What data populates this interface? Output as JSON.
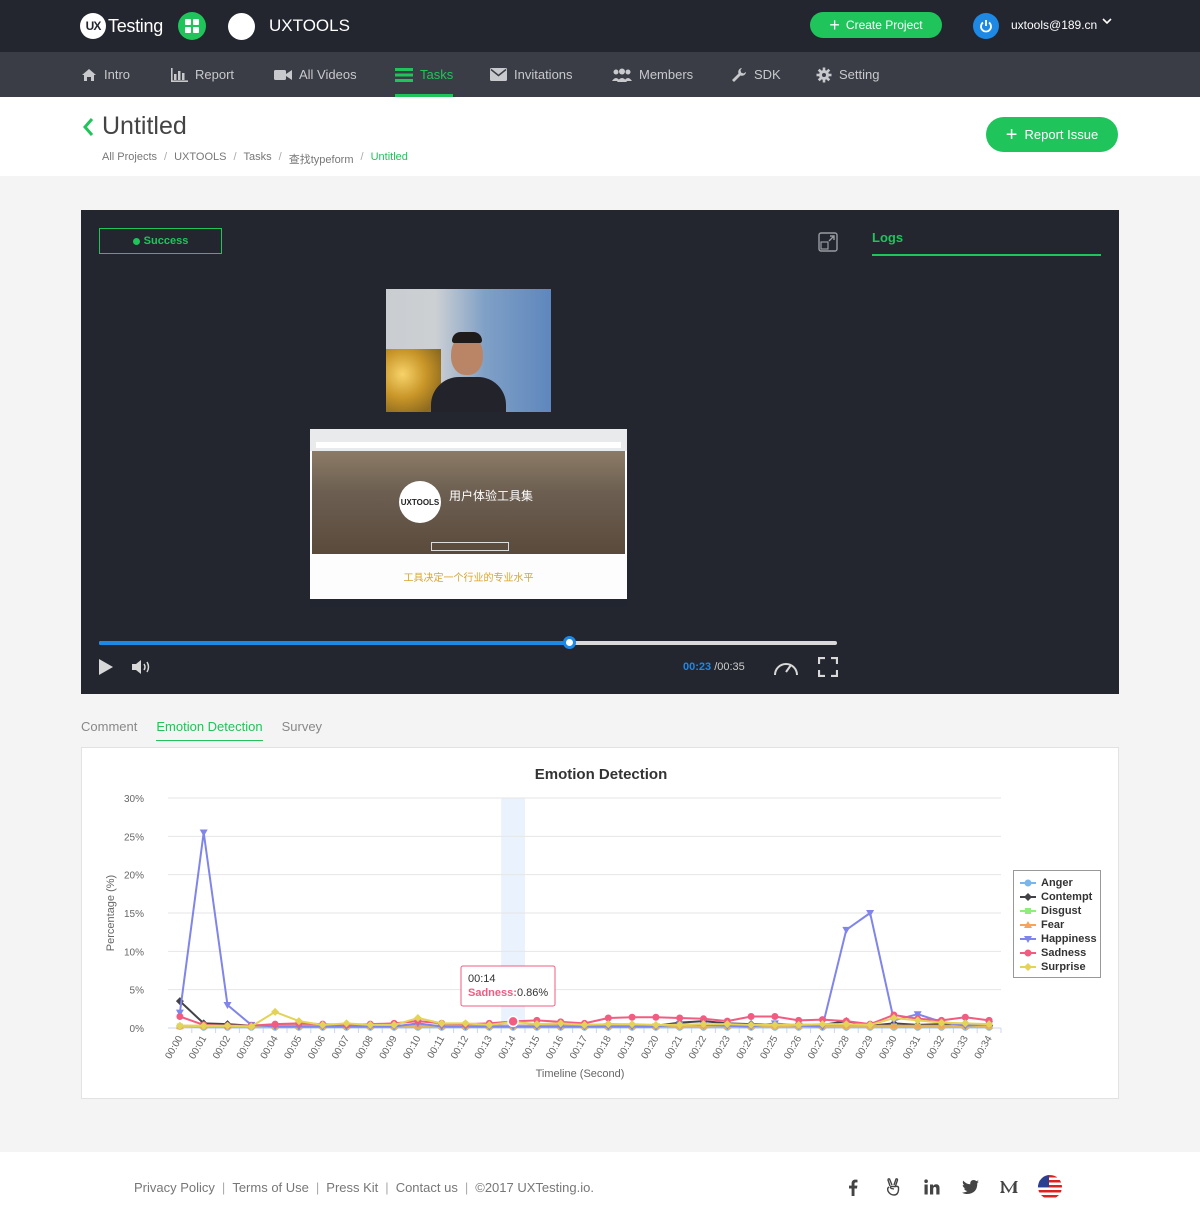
{
  "topbar": {
    "logo_badge": "UX",
    "logo_text": "Testing",
    "project_name": "UXTOOLS",
    "create_label": "Create Project",
    "user_email": "uxtools@189.cn"
  },
  "nav": {
    "items": [
      {
        "label": "Intro",
        "icon": "home-icon"
      },
      {
        "label": "Report",
        "icon": "bar-chart-icon"
      },
      {
        "label": "All Videos",
        "icon": "video-icon"
      },
      {
        "label": "Tasks",
        "icon": "tasks-icon",
        "active": true
      },
      {
        "label": "Invitations",
        "icon": "envelope-icon"
      },
      {
        "label": "Members",
        "icon": "users-icon"
      },
      {
        "label": "SDK",
        "icon": "wrench-icon"
      },
      {
        "label": "Setting",
        "icon": "gear-icon"
      }
    ]
  },
  "page": {
    "title": "Untitled",
    "breadcrumb": [
      "All Projects",
      "UXTOOLS",
      "Tasks",
      "查找typeform",
      "Untitled"
    ],
    "report_label": "Report Issue"
  },
  "player": {
    "status": "Success",
    "logs_label": "Logs",
    "current_time": "00:23",
    "total_time": "/00:35",
    "progress": 0.637,
    "screen_title": "用户体验工具集",
    "screen_tagline": "工具决定一个行业的专业水平",
    "screen_logo": "UXTOOLS"
  },
  "tabs": [
    {
      "label": "Comment"
    },
    {
      "label": "Emotion Detection",
      "active": true
    },
    {
      "label": "Survey"
    }
  ],
  "chart_data": {
    "type": "line",
    "title": "Emotion Detection",
    "xlabel": "Timeline (Second)",
    "ylabel": "Percentage (%)",
    "ylim": [
      0,
      30
    ],
    "yticks": [
      "0%",
      "5%",
      "10%",
      "15%",
      "20%",
      "25%",
      "30%"
    ],
    "x": [
      "00:00",
      "00:01",
      "00:02",
      "00:03",
      "00:04",
      "00:05",
      "00:06",
      "00:07",
      "00:08",
      "00:09",
      "00:10",
      "00:11",
      "00:12",
      "00:13",
      "00:14",
      "00:15",
      "00:16",
      "00:17",
      "00:18",
      "00:19",
      "00:20",
      "00:21",
      "00:22",
      "00:23",
      "00:24",
      "00:25",
      "00:26",
      "00:27",
      "00:28",
      "00:29",
      "00:30",
      "00:31",
      "00:32",
      "00:33",
      "00:34"
    ],
    "legend_position": "right",
    "series": [
      {
        "name": "Anger",
        "color": "#7cb5ec",
        "marker": "circle",
        "values": [
          0.2,
          0.1,
          0.1,
          0.1,
          0.1,
          0.1,
          0.1,
          0.1,
          0.1,
          0.1,
          0.1,
          0.1,
          0.1,
          0.1,
          0.1,
          0.1,
          0.1,
          0.1,
          0.1,
          0.1,
          0.1,
          0.1,
          0.1,
          0.1,
          0.1,
          0.1,
          0.1,
          0.1,
          0.1,
          0.1,
          0.1,
          0.1,
          0.1,
          0.1,
          0.1
        ]
      },
      {
        "name": "Contempt",
        "color": "#434348",
        "marker": "diamond",
        "values": [
          3.5,
          0.6,
          0.5,
          0.3,
          0.3,
          0.3,
          0.3,
          0.3,
          0.3,
          0.3,
          0.3,
          0.3,
          0.3,
          0.3,
          0.3,
          0.3,
          0.3,
          0.3,
          0.5,
          0.4,
          0.3,
          0.7,
          0.9,
          0.6,
          0.5,
          0.4,
          0.4,
          0.4,
          0.9,
          0.3,
          0.6,
          0.4,
          0.5,
          0.6,
          0.3
        ]
      },
      {
        "name": "Disgust",
        "color": "#90ed7d",
        "marker": "square",
        "values": [
          0.2,
          0.2,
          0.2,
          0.2,
          0.2,
          0.2,
          0.2,
          0.2,
          0.2,
          0.2,
          0.2,
          0.2,
          0.2,
          0.2,
          0.2,
          0.2,
          0.2,
          0.2,
          0.2,
          0.2,
          0.2,
          0.2,
          0.2,
          0.2,
          0.2,
          0.2,
          0.2,
          0.2,
          0.2,
          0.2,
          0.2,
          0.2,
          0.2,
          0.2,
          0.2
        ]
      },
      {
        "name": "Fear",
        "color": "#f7a35c",
        "marker": "triangle-up",
        "values": [
          0.3,
          0.3,
          0.3,
          0.3,
          0.3,
          0.3,
          0.3,
          0.3,
          0.3,
          0.3,
          0.3,
          0.3,
          0.3,
          0.3,
          0.3,
          0.3,
          0.3,
          0.3,
          0.3,
          0.3,
          0.3,
          0.3,
          0.3,
          0.3,
          0.3,
          0.3,
          0.3,
          0.3,
          0.3,
          0.3,
          0.3,
          0.3,
          0.3,
          0.3,
          0.3
        ]
      },
      {
        "name": "Happiness",
        "color": "#8085e9",
        "marker": "triangle-down",
        "values": [
          2.0,
          25.5,
          3.0,
          0.4,
          0.2,
          0.2,
          0.2,
          0.2,
          0.2,
          0.2,
          0.6,
          0.2,
          0.2,
          0.2,
          0.2,
          0.2,
          0.2,
          0.2,
          0.2,
          0.2,
          0.2,
          0.5,
          0.4,
          0.3,
          0.2,
          0.6,
          0.3,
          0.2,
          12.8,
          15.0,
          1.0,
          1.8,
          0.8,
          0.3,
          0.5
        ]
      },
      {
        "name": "Sadness",
        "color": "#f15c80",
        "marker": "circle",
        "values": [
          1.5,
          0.4,
          0.3,
          0.3,
          0.5,
          0.6,
          0.5,
          0.4,
          0.5,
          0.6,
          0.9,
          0.6,
          0.5,
          0.6,
          0.86,
          1.0,
          0.8,
          0.6,
          1.3,
          1.4,
          1.4,
          1.3,
          1.2,
          0.9,
          1.5,
          1.5,
          1.0,
          1.1,
          0.9,
          0.5,
          1.7,
          1.2,
          1.0,
          1.4,
          1.0
        ]
      },
      {
        "name": "Surprise",
        "color": "#e4d354",
        "marker": "diamond",
        "values": [
          0.3,
          0.3,
          0.3,
          0.2,
          2.1,
          0.9,
          0.4,
          0.6,
          0.4,
          0.4,
          1.3,
          0.6,
          0.6,
          0.4,
          0.8,
          0.5,
          0.6,
          0.4,
          0.5,
          0.5,
          0.4,
          0.4,
          0.5,
          0.5,
          0.4,
          0.4,
          0.4,
          0.5,
          0.5,
          0.4,
          1.3,
          1.0,
          0.7,
          0.6,
          0.5
        ]
      }
    ],
    "tooltip": {
      "x": "00:14",
      "label": "Sadness:",
      "value": "0.86%"
    }
  },
  "footer": {
    "links": [
      "Privacy Policy",
      "Terms of Use",
      "Press Kit",
      "Contact us"
    ],
    "copyright": "©2017 UXTesting.io.",
    "socials": [
      "facebook-icon",
      "angellist-icon",
      "linkedin-icon",
      "twitter-icon",
      "medium-icon",
      "us-flag-icon"
    ]
  }
}
